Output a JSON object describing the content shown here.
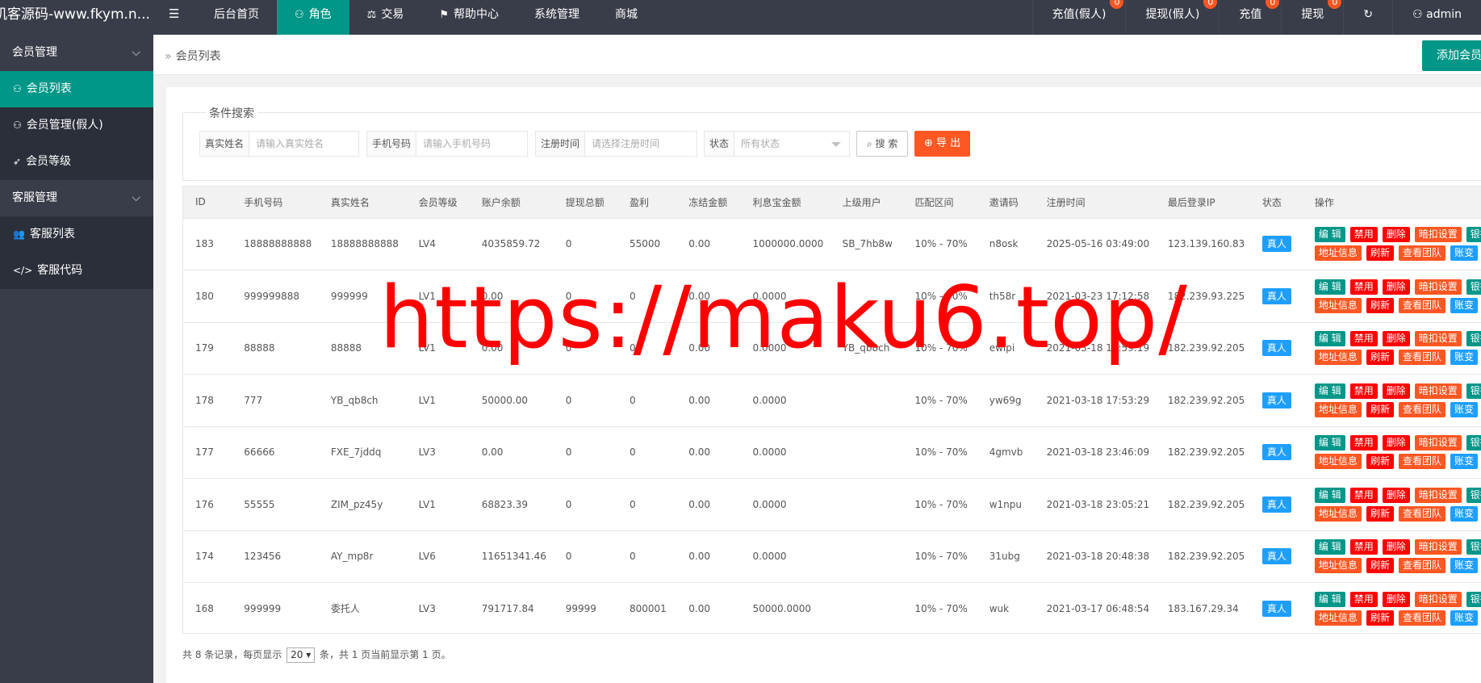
{
  "header": {
    "logo": "机客源码-www.fkym.n...",
    "nav": [
      {
        "label": "后台首页",
        "icon": "",
        "active": false
      },
      {
        "label": "角色",
        "icon": "user-icon",
        "active": true
      },
      {
        "label": "交易",
        "icon": "scale-icon",
        "active": false
      },
      {
        "label": "帮助中心",
        "icon": "flag-icon",
        "active": false
      },
      {
        "label": "系统管理",
        "icon": "",
        "active": false
      },
      {
        "label": "商城",
        "icon": "",
        "active": false
      }
    ],
    "right": [
      {
        "label": "充值(假人)",
        "badge": "0"
      },
      {
        "label": "提现(假人)",
        "badge": "0"
      },
      {
        "label": "充值",
        "badge": "0"
      },
      {
        "label": "提现",
        "badge": "0"
      },
      {
        "label": "↻",
        "badge": ""
      },
      {
        "label": "admin",
        "badge": ""
      }
    ]
  },
  "sidebar": {
    "groups": [
      {
        "label": "会员管理",
        "items": [
          {
            "label": "会员列表",
            "icon": "user-icon",
            "active": true
          },
          {
            "label": "会员管理(假人)",
            "icon": "user-icon",
            "active": false
          },
          {
            "label": "会员等级",
            "icon": "rocket-icon",
            "active": false
          }
        ]
      },
      {
        "label": "客服管理",
        "items": [
          {
            "label": "客服列表",
            "icon": "users-icon",
            "active": false
          },
          {
            "label": "客服代码",
            "icon": "code-icon",
            "active": false
          }
        ]
      }
    ]
  },
  "breadcrumb": "会员列表",
  "add_button": "添加会员",
  "search": {
    "legend": "条件搜索",
    "name_label": "真实姓名",
    "name_placeholder": "请输入真实姓名",
    "phone_label": "手机号码",
    "phone_placeholder": "请输入手机号码",
    "time_label": "注册时间",
    "time_placeholder": "请选择注册时间",
    "status_label": "状态",
    "status_value": "所有状态",
    "search_button": "搜 索",
    "export_button": "导 出"
  },
  "table": {
    "columns": [
      "ID",
      "手机号码",
      "真实姓名",
      "会员等级",
      "账户余额",
      "提现总额",
      "盈利",
      "冻结金额",
      "利息宝金额",
      "上级用户",
      "匹配区间",
      "邀请码",
      "注册时间",
      "最后登录IP",
      "状态",
      "操作"
    ],
    "rows": [
      [
        "183",
        "18888888888",
        "18888888888",
        "LV4",
        "4035859.72",
        "0",
        "55000",
        "0.00",
        "1000000.0000",
        "SB_7hb8w",
        "10% - 70%",
        "n8osk",
        "2025-05-16 03:49:00",
        "123.139.160.83",
        "真人"
      ],
      [
        "180",
        "999999888",
        "999999",
        "LV1",
        "0.00",
        "0",
        "0",
        "0.00",
        "0.0000",
        "",
        "10% - 70%",
        "th58r",
        "2021-03-23 17:12:58",
        "182.239.93.225",
        "真人"
      ],
      [
        "179",
        "88888",
        "88888",
        "LV1",
        "0.00",
        "0",
        "0",
        "0.00",
        "0.0000",
        "YB_qb8ch",
        "10% - 70%",
        "ewlpi",
        "2021-03-18 18:59:19",
        "182.239.92.205",
        "真人"
      ],
      [
        "178",
        "777",
        "YB_qb8ch",
        "LV1",
        "50000.00",
        "0",
        "0",
        "0.00",
        "0.0000",
        "",
        "10% - 70%",
        "yw69g",
        "2021-03-18 17:53:29",
        "182.239.92.205",
        "真人"
      ],
      [
        "177",
        "66666",
        "FXE_7jddq",
        "LV3",
        "0.00",
        "0",
        "0",
        "0.00",
        "0.0000",
        "",
        "10% - 70%",
        "4gmvb",
        "2021-03-18 23:46:09",
        "182.239.92.205",
        "真人"
      ],
      [
        "176",
        "55555",
        "ZIM_pz45y",
        "LV1",
        "68823.39",
        "0",
        "0",
        "0.00",
        "0.0000",
        "",
        "10% - 70%",
        "w1npu",
        "2021-03-18 23:05:21",
        "182.239.92.205",
        "真人"
      ],
      [
        "174",
        "123456",
        "AY_mp8r",
        "LV6",
        "11651341.46",
        "0",
        "0",
        "0.00",
        "0.0000",
        "",
        "10% - 70%",
        "31ubg",
        "2021-03-18 20:48:38",
        "182.239.92.205",
        "真人"
      ],
      [
        "168",
        "999999",
        "委托人",
        "LV3",
        "791717.84",
        "99999",
        "800001",
        "0.00",
        "50000.0000",
        "",
        "10% - 70%",
        "wuk",
        "2021-03-17 06:48:54",
        "183.167.29.34",
        "真人"
      ]
    ],
    "ops_row1": [
      {
        "label": "编 辑",
        "color": "green"
      },
      {
        "label": "禁用",
        "color": "red"
      },
      {
        "label": "删除",
        "color": "red"
      },
      {
        "label": "暗扣设置",
        "color": "orange"
      },
      {
        "label": "银行",
        "color": "teal"
      }
    ],
    "ops_row2": [
      {
        "label": "地址信息",
        "color": "orange"
      },
      {
        "label": "刷新",
        "color": "red"
      },
      {
        "label": "查看团队",
        "color": "orange"
      },
      {
        "label": "账变",
        "color": "blue"
      },
      {
        "label": "",
        "color": "green"
      }
    ]
  },
  "pager": {
    "prefix": "共 8 条记录，每页显示",
    "per_page": "20",
    "suffix": "条，共 1 页当前显示第 1 页。"
  },
  "watermark": "https://maku6.top/"
}
